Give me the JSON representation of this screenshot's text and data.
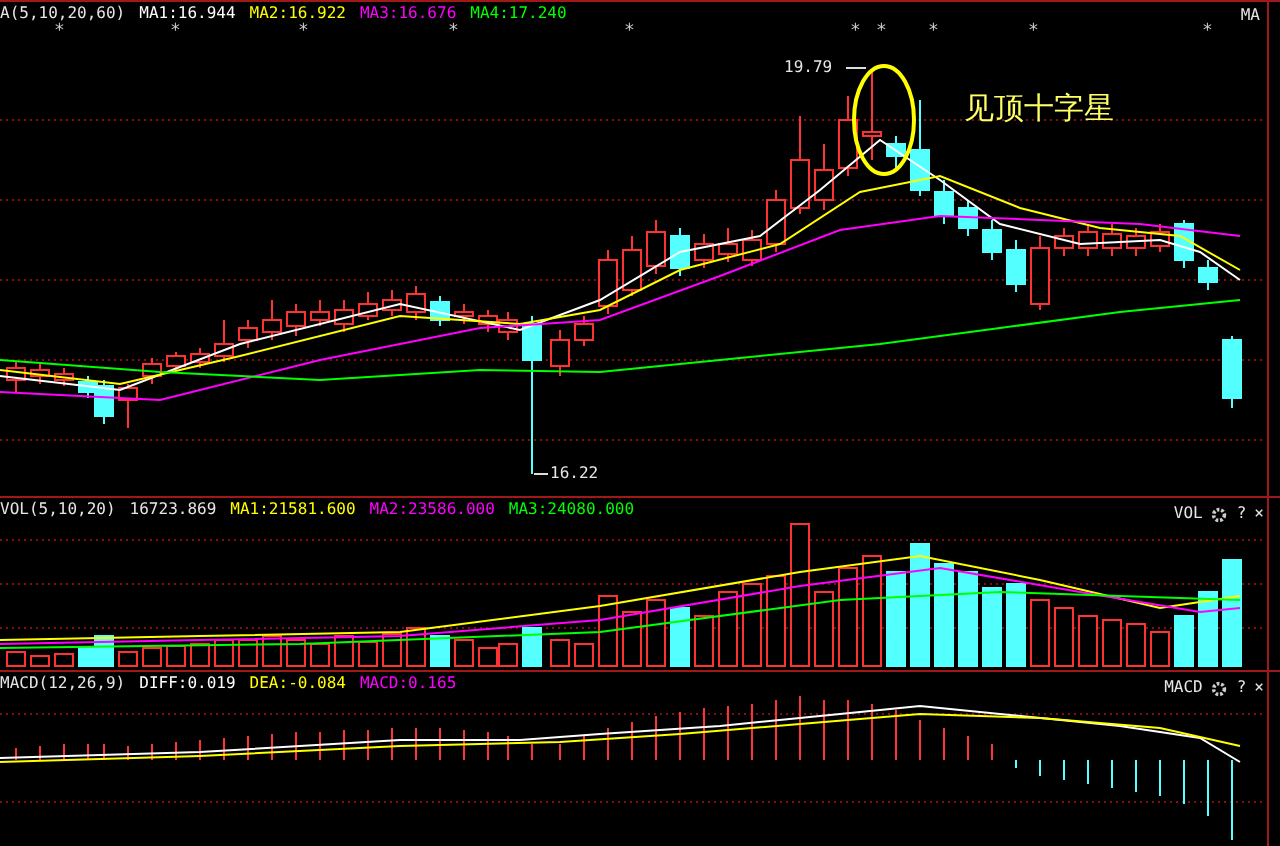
{
  "price_panel": {
    "indicator": "A(5,10,20,60)",
    "ma": [
      {
        "label": "MA1:16.944",
        "color": "#ffffff"
      },
      {
        "label": "MA2:16.922",
        "color": "#ffff00"
      },
      {
        "label": "MA3:16.676",
        "color": "#ff00ff"
      },
      {
        "label": "MA4:17.240",
        "color": "#00ff00"
      }
    ],
    "corner_label": "MA",
    "markers": [
      "*",
      "*",
      "*",
      "*",
      "*",
      "*",
      "*",
      "*",
      "*",
      "*"
    ],
    "high_label": "19.79",
    "low_label": "16.22",
    "annotation": "见顶十字星"
  },
  "volume_panel": {
    "indicator": "VOL(5,10,20)",
    "value": "16723.869",
    "ma": [
      {
        "label": "MA1:21581.600",
        "color": "#ffff00"
      },
      {
        "label": "MA2:23586.000",
        "color": "#ff00ff"
      },
      {
        "label": "MA3:24080.000",
        "color": "#00ff00"
      }
    ],
    "corner_label": "VOL",
    "help": "?",
    "close": "×"
  },
  "macd_panel": {
    "indicator": "MACD(12,26,9)",
    "ma": [
      {
        "label": "DIFF:0.019",
        "color": "#ffffff"
      },
      {
        "label": "DEA:-0.084",
        "color": "#ffff00"
      },
      {
        "label": "MACD:0.165",
        "color": "#ff00ff"
      }
    ],
    "corner_label": "MACD",
    "help": "?",
    "close": "×"
  }
}
